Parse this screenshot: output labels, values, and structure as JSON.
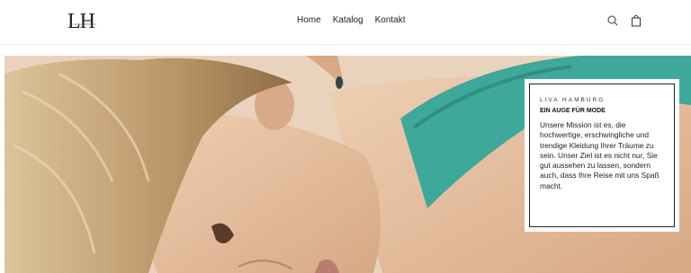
{
  "header": {
    "logo": {
      "letters": "LH",
      "sub": "LIVA HAMBURG"
    },
    "nav": [
      {
        "label": "Home"
      },
      {
        "label": "Katalog"
      },
      {
        "label": "Kontakt"
      }
    ],
    "icons": [
      "search-icon",
      "cart-icon"
    ]
  },
  "hero": {
    "card": {
      "brand": "LIVA HAMBURG",
      "tagline": "EIN AUGE FÜR MODE",
      "text": "Unsere Mission ist es, die hochwertige, erschwingliche und trendige Kleidung Ihrer Träume zu sein. Unser Ziel ist es nicht nur, Sie gut aussehen zu lassen, sondern auch, dass Ihre Reise mit uns Spaß macht."
    }
  },
  "colors": {
    "background": "#ffffff",
    "skin": "#e8c5a6",
    "hair": "#c9a878",
    "top": "#3ea89a"
  }
}
